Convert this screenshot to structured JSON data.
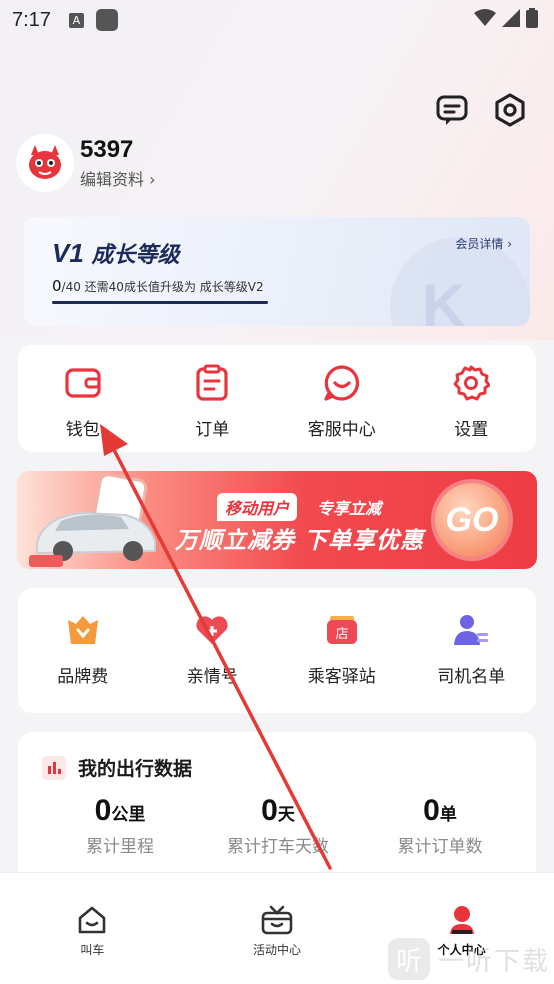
{
  "status_bar": {
    "time": "7:17",
    "notif_letter": "A"
  },
  "header_icons": [
    "message-icon",
    "settings-hex-icon"
  ],
  "profile": {
    "user_id": "5397",
    "edit_label": "编辑资料 ›"
  },
  "vip": {
    "level": "V1",
    "level_name": "成长等级",
    "detail_link": "会员详情 ›",
    "progress_current": "0",
    "progress_rest": "/40 还需40成长值升级为 成长等级V2",
    "progress_fraction": 0
  },
  "quick_actions": [
    {
      "label": "钱包",
      "icon": "wallet-icon"
    },
    {
      "label": "订单",
      "icon": "order-icon"
    },
    {
      "label": "客服中心",
      "icon": "customer-service-icon"
    },
    {
      "label": "设置",
      "icon": "gear-icon"
    }
  ],
  "banner": {
    "tag": "移动用户",
    "subtitle": "专享立减",
    "headline": "万顺立减券 下单享优惠",
    "go": "GO"
  },
  "services": [
    {
      "label": "品牌费",
      "icon": "brand-fee-icon"
    },
    {
      "label": "亲情号",
      "icon": "family-number-icon"
    },
    {
      "label": "乘客驿站",
      "icon": "passenger-station-icon"
    },
    {
      "label": "司机名单",
      "icon": "driver-list-icon"
    }
  ],
  "trip_stats": {
    "title": "我的出行数据",
    "items": [
      {
        "value": "0",
        "unit": "公里",
        "label": "累计里程"
      },
      {
        "value": "0",
        "unit": "天",
        "label": "累计打车天数"
      },
      {
        "value": "0",
        "unit": "单",
        "label": "累计订单数"
      }
    ]
  },
  "tabbar": [
    {
      "label": "叫车",
      "icon": "home-car-icon",
      "active": false
    },
    {
      "label": "活动中心",
      "icon": "activity-box-icon",
      "active": false
    },
    {
      "label": "个人中心",
      "icon": "person-icon",
      "active": true
    }
  ],
  "watermark": {
    "glyph": "听",
    "text": "一听下载"
  },
  "colors": {
    "accent": "#e8353d",
    "vip_text": "#1c2a5a",
    "background": "#f4f4f6"
  }
}
